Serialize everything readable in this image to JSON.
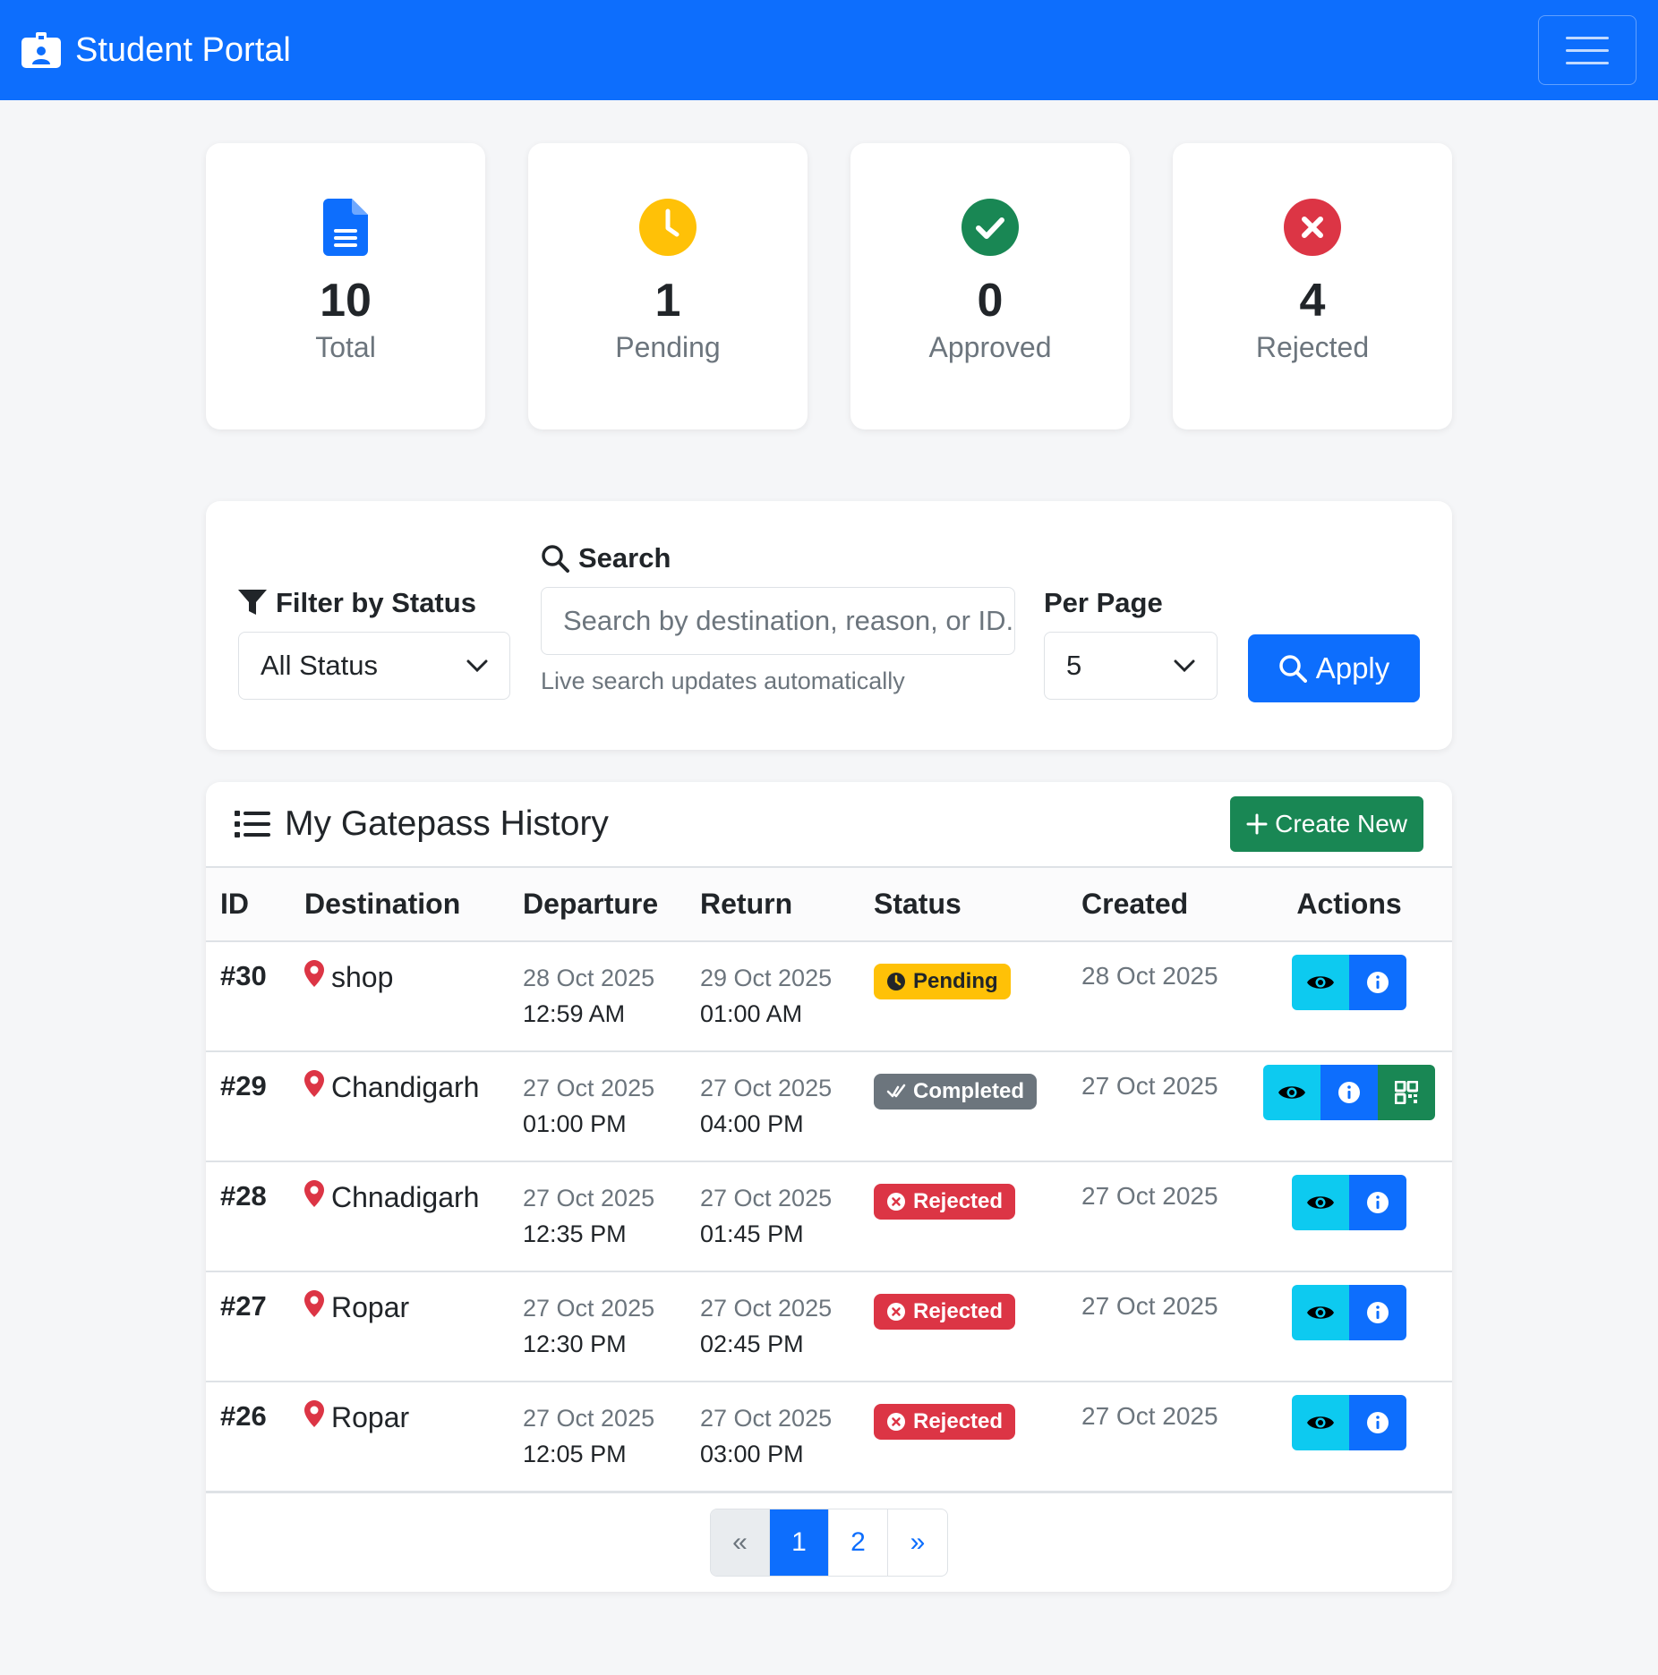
{
  "navbar": {
    "brand": "Student Portal"
  },
  "stats": [
    {
      "value": "10",
      "label": "Total",
      "icon": "file-icon",
      "color": "#0d6efd"
    },
    {
      "value": "1",
      "label": "Pending",
      "icon": "clock-icon",
      "color": "#ffc107"
    },
    {
      "value": "0",
      "label": "Approved",
      "icon": "check-circle-icon",
      "color": "#198754"
    },
    {
      "value": "4",
      "label": "Rejected",
      "icon": "x-circle-icon",
      "color": "#dc3545"
    }
  ],
  "filter": {
    "status_label": "Filter by Status",
    "status_value": "All Status",
    "search_label": "Search",
    "search_placeholder": "Search by destination, reason, or ID...",
    "search_help": "Live search updates automatically",
    "per_page_label": "Per Page",
    "per_page_value": "5",
    "apply_label": "Apply"
  },
  "history": {
    "title": "My Gatepass History",
    "create_label": "Create New",
    "columns": [
      "ID",
      "Destination",
      "Departure",
      "Return",
      "Status",
      "Created",
      "Actions"
    ],
    "rows": [
      {
        "id": "#30",
        "destination": "shop",
        "dep_date": "28 Oct 2025",
        "dep_time": "12:59 AM",
        "ret_date": "29 Oct 2025",
        "ret_time": "01:00 AM",
        "status": "Pending",
        "created": "28 Oct 2025"
      },
      {
        "id": "#29",
        "destination": "Chandigarh",
        "dep_date": "27 Oct 2025",
        "dep_time": "01:00 PM",
        "ret_date": "27 Oct 2025",
        "ret_time": "04:00 PM",
        "status": "Completed",
        "created": "27 Oct 2025"
      },
      {
        "id": "#28",
        "destination": "Chnadigarh",
        "dep_date": "27 Oct 2025",
        "dep_time": "12:35 PM",
        "ret_date": "27 Oct 2025",
        "ret_time": "01:45 PM",
        "status": "Rejected",
        "created": "27 Oct 2025"
      },
      {
        "id": "#27",
        "destination": "Ropar",
        "dep_date": "27 Oct 2025",
        "dep_time": "12:30 PM",
        "ret_date": "27 Oct 2025",
        "ret_time": "02:45 PM",
        "status": "Rejected",
        "created": "27 Oct 2025"
      },
      {
        "id": "#26",
        "destination": "Ropar",
        "dep_date": "27 Oct 2025",
        "dep_time": "12:05 PM",
        "ret_date": "27 Oct 2025",
        "ret_time": "03:00 PM",
        "status": "Rejected",
        "created": "27 Oct 2025"
      }
    ]
  },
  "pagination": {
    "prev": "«",
    "pages": [
      "1",
      "2"
    ],
    "next": "»",
    "active": "1"
  }
}
